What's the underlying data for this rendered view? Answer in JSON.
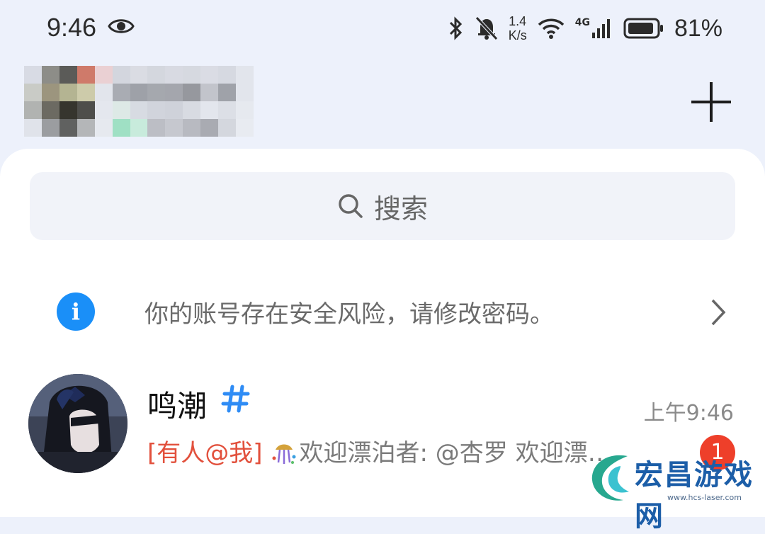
{
  "status_bar": {
    "time": "9:46",
    "net_speed_value": "1.4",
    "net_speed_unit": "K/s",
    "network_type": "4G",
    "battery_percent": "81%",
    "icons": [
      "eye-icon",
      "bluetooth-icon",
      "bell-off-icon",
      "wifi-icon",
      "signal-icon",
      "battery-icon"
    ]
  },
  "header": {
    "add_icon": "plus-icon"
  },
  "search": {
    "placeholder": "搜索",
    "icon": "search-icon"
  },
  "security_notice": {
    "text": "你的账号存在安全风险，请修改密码。",
    "icon": "info-icon",
    "accent_color": "#1a8ff8"
  },
  "conversations": [
    {
      "name": "鸣潮",
      "name_icon": "hash-icon",
      "time": "上午9:46",
      "mention_tag": "[有人@我]",
      "preview_icon": "party-popper-icon",
      "preview": "欢迎漂泊者: @杏罗 欢迎漂…",
      "unread_count": "1",
      "badge_color": "#ee3f2a",
      "mention_color": "#e2503c"
    }
  ],
  "watermark": {
    "text": "宏昌游戏网",
    "url": "www.hcs-laser.com"
  }
}
